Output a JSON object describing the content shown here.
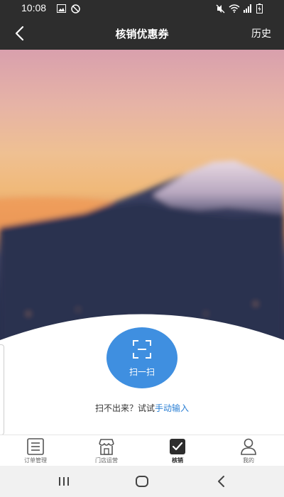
{
  "status_bar": {
    "time": "10:08",
    "icons": [
      "image-icon",
      "block-icon",
      "mute-icon",
      "wifi-icon",
      "signal-icon",
      "battery-icon"
    ]
  },
  "nav": {
    "title": "核销优惠券",
    "history_label": "历史",
    "back_icon": "chevron-left-icon"
  },
  "scan": {
    "label": "扫一扫",
    "icon": "scan-frame-icon"
  },
  "hint": {
    "text": "扫不出来？试试",
    "link": "手动输入"
  },
  "tabbar": {
    "items": [
      {
        "label": "订单管理",
        "icon": "order-list-icon",
        "active": false
      },
      {
        "label": "门店运营",
        "icon": "store-icon",
        "active": false
      },
      {
        "label": "核销",
        "icon": "check-box-icon",
        "active": true
      },
      {
        "label": "我的",
        "icon": "person-icon",
        "active": false
      }
    ]
  },
  "system_nav": [
    "recent-apps-icon",
    "home-icon",
    "back-icon"
  ],
  "colors": {
    "bar": "#2d2d2d",
    "accent": "#3f8fe0",
    "link": "#2a7fd4"
  }
}
